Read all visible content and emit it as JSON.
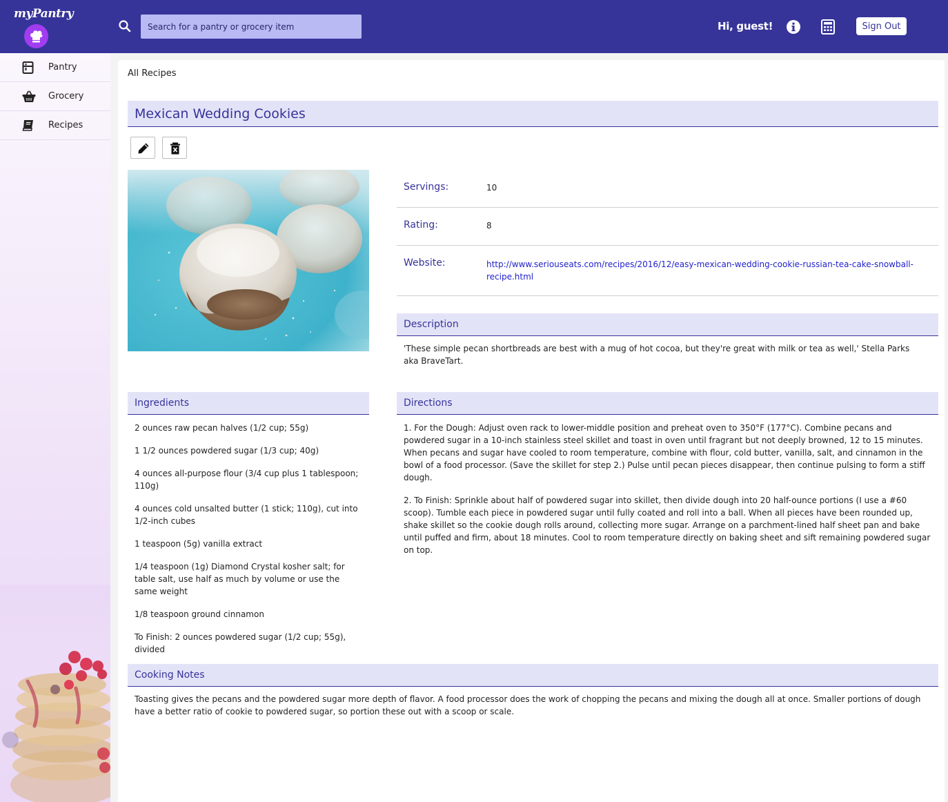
{
  "app": {
    "logo_text": "myPantry"
  },
  "header": {
    "search_placeholder": "Search for a pantry or grocery item",
    "greeting": "Hi,  guest!",
    "sign_out_label": "Sign Out",
    "icons": [
      "search-icon",
      "info-icon",
      "calculator-icon",
      "chef-hat-icon"
    ],
    "colors": {
      "bar": "#363399",
      "search_field": "#b9b9f4",
      "logo_badge": "#a13cf0"
    }
  },
  "sidebar": {
    "items": [
      {
        "label": "Pantry",
        "icon": "pantry-icon"
      },
      {
        "label": "Grocery",
        "icon": "basket-icon"
      },
      {
        "label": "Recipes",
        "icon": "book-icon"
      }
    ]
  },
  "breadcrumb": "All Recipes",
  "recipe": {
    "title": "Mexican Wedding Cookies",
    "servings_label": "Servings:",
    "servings": "10",
    "rating_label": "Rating:",
    "rating": "8",
    "website_label": "Website:",
    "website": "http://www.seriouseats.com/recipes/2016/12/easy-mexican-wedding-cookie-russian-tea-cake-snowball-recipe.html",
    "description_heading": "Description",
    "description": "'These simple pecan shortbreads are best with a mug of hot cocoa, but they're great with milk or tea as well,' Stella Parks aka BraveTart.",
    "ingredients_heading": "Ingredients",
    "ingredients": [
      "2 ounces raw pecan halves (1/2 cup; 55g)",
      "1 1/2 ounces powdered sugar (1/3 cup; 40g)",
      "4 ounces all-purpose flour (3/4 cup plus 1 tablespoon; 110g)",
      "4 ounces cold unsalted butter (1 stick; 110g), cut into 1/2-inch cubes",
      "1 teaspoon (5g) vanilla extract",
      "1/4 teaspoon (1g) Diamond Crystal kosher salt; for table salt, use half as much by volume or use the same weight",
      "1/8 teaspoon ground cinnamon",
      "To Finish: 2 ounces powdered sugar (1/2 cup; 55g), divided"
    ],
    "directions_heading": "Directions",
    "directions": [
      "1. For the Dough: Adjust oven rack to lower-middle position and preheat oven to 350°F (177°C). Combine pecans and powdered sugar in a 10-inch stainless steel skillet and toast in oven until fragrant but not deeply browned, 12 to 15 minutes. When pecans and sugar have cooled to room temperature, combine with flour, cold butter, vanilla, salt, and cinnamon in the bowl of a food processor. (Save the skillet for step 2.) Pulse until pecan pieces disappear, then continue pulsing to form a stiff dough.",
      "2. To Finish: Sprinkle about half of powdered sugar into skillet, then divide dough into 20 half-ounce portions (I use a #60 scoop). Tumble each piece in powdered sugar until fully coated and roll into a ball. When all pieces have been rounded up, shake skillet so the cookie dough rolls around, collecting more sugar. Arrange on a parchment-lined half sheet pan and bake until puffed and firm, about 18 minutes. Cool to room temperature directly on baking sheet and sift remaining powdered sugar on top."
    ],
    "notes_heading": "Cooking Notes",
    "notes": "Toasting gives the pecans and the powdered sugar more depth of flavor. A food processor does the work of chopping the pecans and mixing the dough all at once. Smaller portions of dough have a better ratio of cookie to powdered sugar, so portion these out with a scoop or scale."
  },
  "toolbar": {
    "edit_icon": "pencil-icon",
    "delete_icon": "trash-icon"
  }
}
